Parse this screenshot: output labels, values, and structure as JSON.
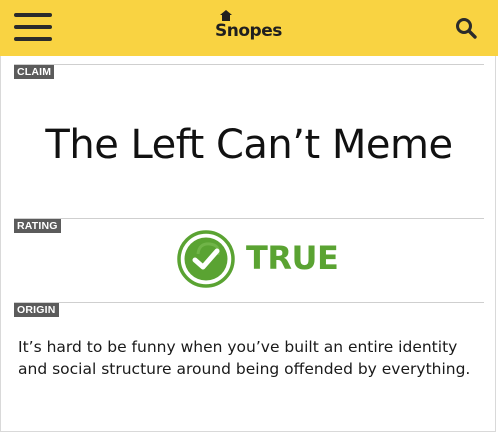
{
  "header": {
    "logo_text": "Snopes",
    "menu_icon": "hamburger-menu-icon",
    "search_icon": "search-icon",
    "bar_color": "#f9d342"
  },
  "claim": {
    "tag": "CLAIM",
    "text": "The Left Can’t Meme"
  },
  "rating": {
    "tag": "RATING",
    "label": "TRUE",
    "icon": "checkmark-badge-icon",
    "color": "#5aa332"
  },
  "origin": {
    "tag": "ORIGIN",
    "text": "It’s hard to be funny when you’ve built an entire identity and social structure around being offended by everything."
  }
}
